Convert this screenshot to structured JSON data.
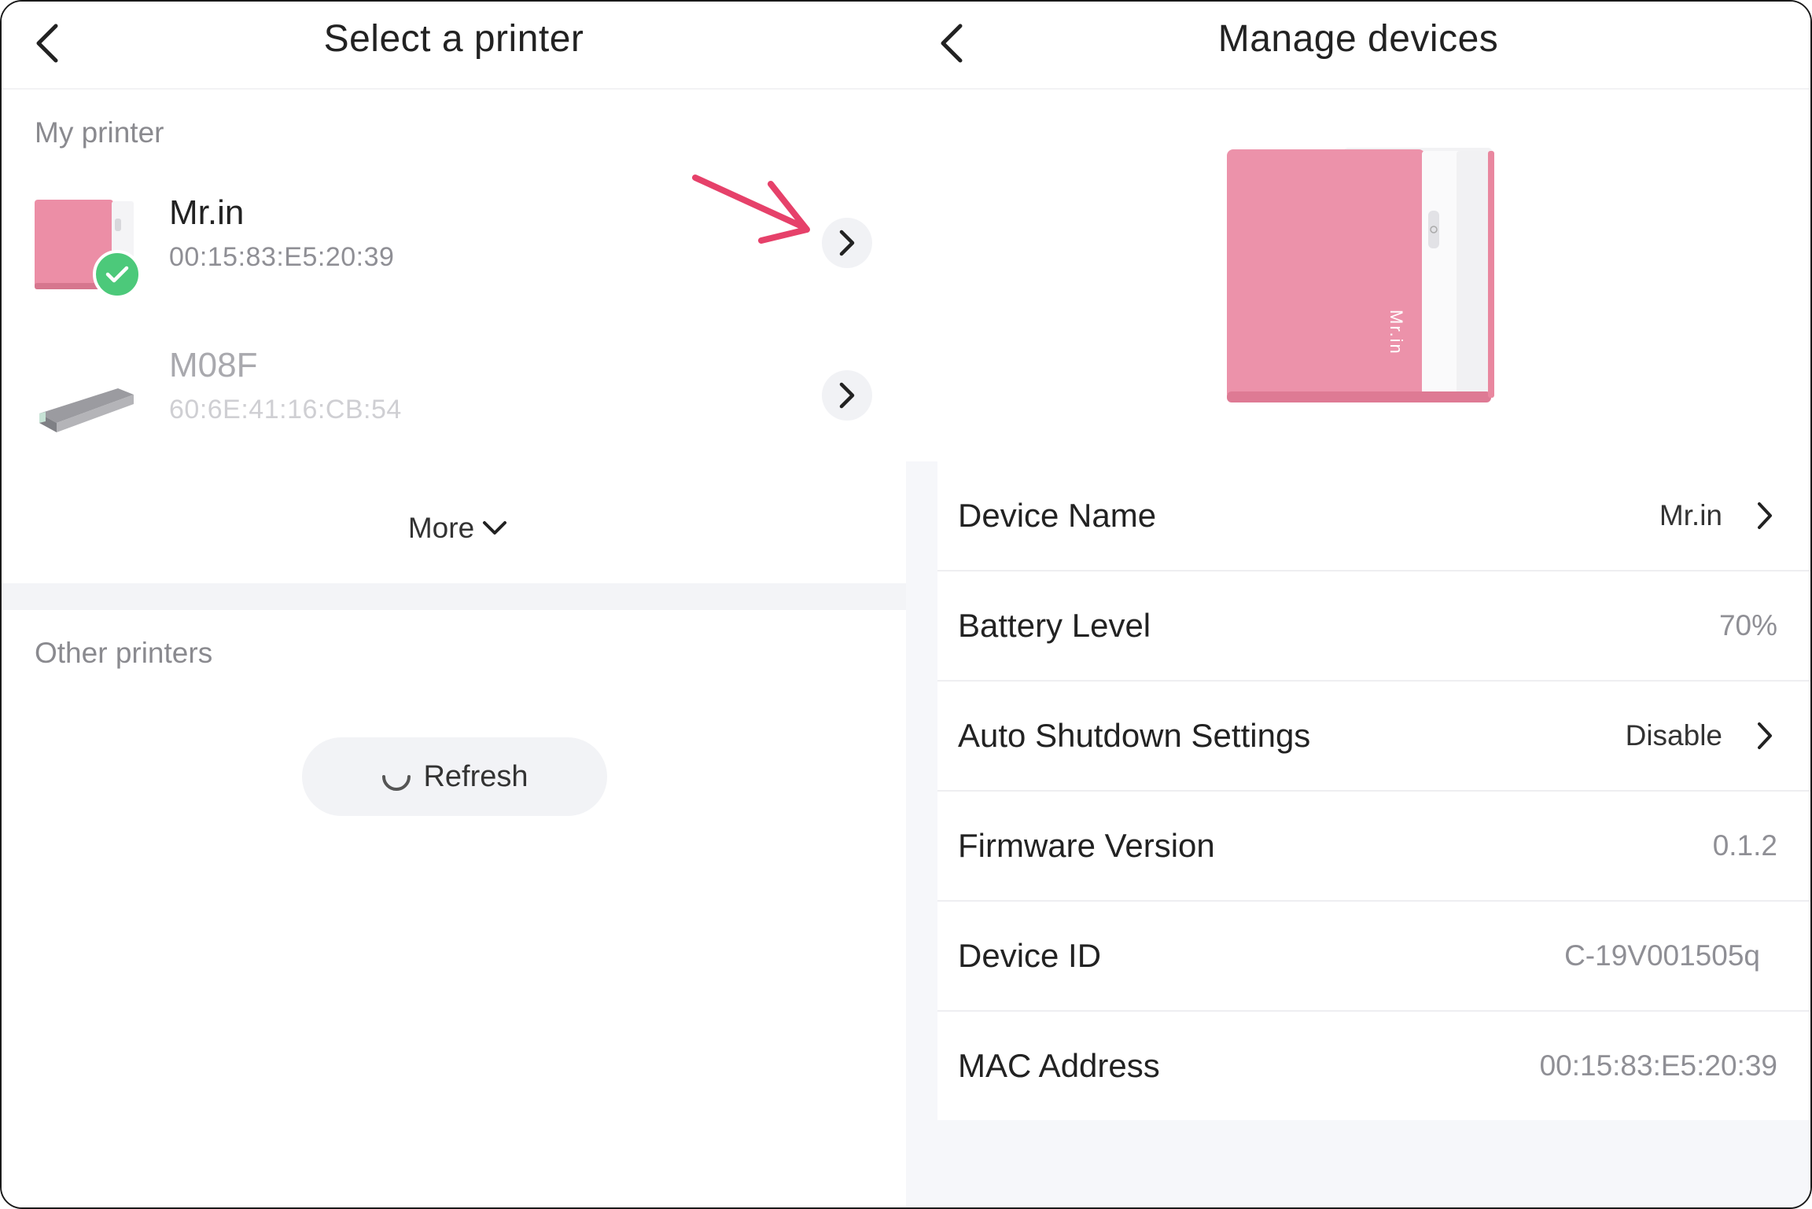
{
  "left": {
    "title": "Select a printer",
    "my_printer_label": "My printer",
    "printers": [
      {
        "name": "Mr.in",
        "mac": "00:15:83:E5:20:39",
        "connected": true
      },
      {
        "name": "M08F",
        "mac": "60:6E:41:16:CB:54",
        "connected": false
      }
    ],
    "more_label": "More",
    "other_printers_label": "Other printers",
    "refresh_label": "Refresh"
  },
  "right": {
    "title": "Manage devices",
    "rows": [
      {
        "label": "Device Name",
        "value": "Mr.in",
        "has_chevron": true
      },
      {
        "label": "Battery Level",
        "value": "70%",
        "has_chevron": false
      },
      {
        "label": "Auto Shutdown Settings",
        "value": "Disable",
        "has_chevron": true
      },
      {
        "label": "Firmware Version",
        "value": "0.1.2",
        "has_chevron": false
      },
      {
        "label": "Device ID",
        "value": "C-19V001505q",
        "has_chevron": false
      },
      {
        "label": "MAC Address",
        "value": "00:15:83:E5:20:39",
        "has_chevron": false
      }
    ],
    "device_logo": "Mr.in"
  },
  "colors": {
    "accent_pink": "#e8899f",
    "arrow_pink": "#e6416a",
    "check_green": "#4cc97a"
  },
  "icons": {
    "back": "chevron-left-icon",
    "row_chevron": "chevron-right-icon",
    "more": "chevron-down-icon",
    "refresh": "spinner-icon",
    "connected": "check-circle-icon"
  }
}
